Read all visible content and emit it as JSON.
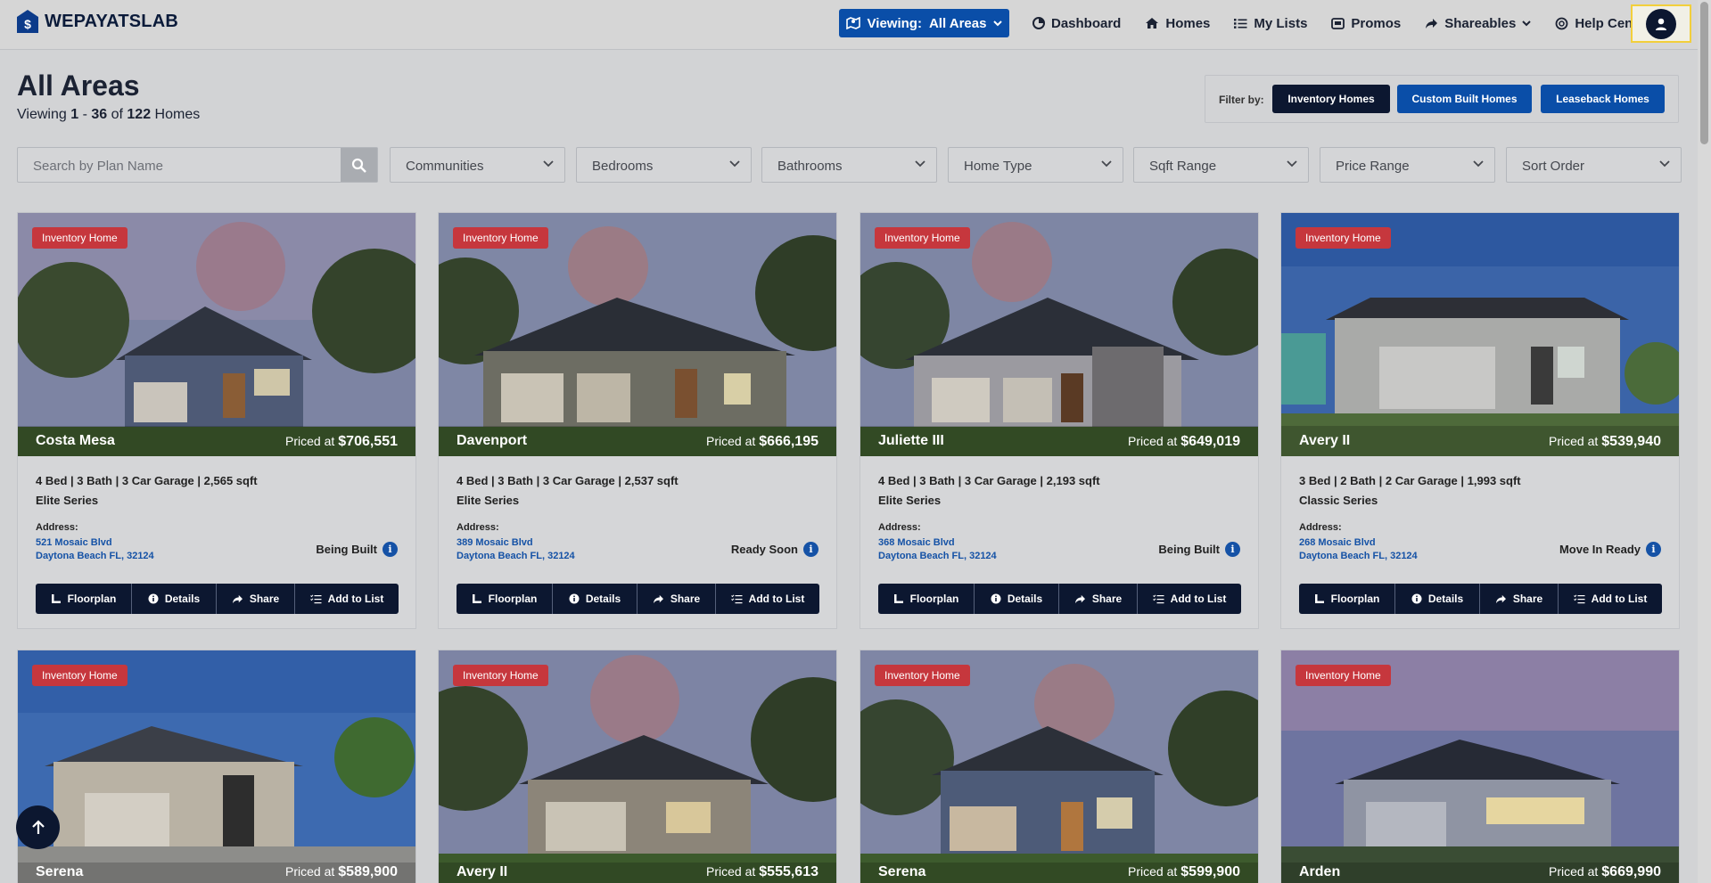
{
  "brand": {
    "name": "WEPAYATSLAB"
  },
  "header": {
    "viewing_label": "Viewing:",
    "viewing_value": "All Areas",
    "nav": [
      {
        "label": "Dashboard",
        "icon": "dashboard-icon"
      },
      {
        "label": "Homes",
        "icon": "home-icon"
      },
      {
        "label": "My Lists",
        "icon": "list-icon"
      },
      {
        "label": "Promos",
        "icon": "promo-icon"
      },
      {
        "label": "Shareables",
        "icon": "share-icon"
      },
      {
        "label": "Help Center",
        "icon": "help-icon"
      }
    ]
  },
  "page": {
    "title": "All Areas",
    "viewing_prefix": "Viewing",
    "range_start": "1",
    "range_sep": "-",
    "range_end": "36",
    "of": "of",
    "total": "122",
    "unit": "Homes"
  },
  "filter": {
    "label": "Filter by:",
    "buttons": [
      "Inventory Homes",
      "Custom Built Homes",
      "Leaseback Homes"
    ]
  },
  "search": {
    "placeholder": "Search by Plan Name"
  },
  "dropdowns": [
    "Communities",
    "Bedrooms",
    "Bathrooms",
    "Home Type",
    "Sqft Range",
    "Price Range",
    "Sort Order"
  ],
  "card_actions": [
    "Floorplan",
    "Details",
    "Share",
    "Add to List"
  ],
  "address_label": "Address:",
  "price_prefix": "Priced at",
  "homes": [
    {
      "badge": "Inventory Home",
      "name": "Costa Mesa",
      "price": "$706,551",
      "specs": "4 Bed | 3 Bath | 3 Car Garage | 2,565 sqft",
      "series": "Elite Series",
      "addr1": "521 Mosaic Blvd",
      "addr2": "Daytona Beach FL, 32124",
      "status": "Being Built"
    },
    {
      "badge": "Inventory Home",
      "name": "Davenport",
      "price": "$666,195",
      "specs": "4 Bed | 3 Bath | 3 Car Garage | 2,537 sqft",
      "series": "Elite Series",
      "addr1": "389 Mosaic Blvd",
      "addr2": "Daytona Beach FL, 32124",
      "status": "Ready Soon"
    },
    {
      "badge": "Inventory Home",
      "name": "Juliette III",
      "price": "$649,019",
      "specs": "4 Bed | 3 Bath | 3 Car Garage | 2,193 sqft",
      "series": "Elite Series",
      "addr1": "368 Mosaic Blvd",
      "addr2": "Daytona Beach FL, 32124",
      "status": "Being Built"
    },
    {
      "badge": "Inventory Home",
      "name": "Avery II",
      "price": "$539,940",
      "specs": "3 Bed | 2 Bath | 2 Car Garage | 1,993 sqft",
      "series": "Classic Series",
      "addr1": "268 Mosaic Blvd",
      "addr2": "Daytona Beach FL, 32124",
      "status": "Move In Ready"
    },
    {
      "badge": "Inventory Home",
      "name": "Serena",
      "price": "$589,900"
    },
    {
      "badge": "Inventory Home",
      "name": "Avery II",
      "price": "$555,613"
    },
    {
      "badge": "Inventory Home",
      "name": "Serena",
      "price": "$599,900"
    },
    {
      "badge": "Inventory Home",
      "name": "Arden",
      "price": "$669,990"
    }
  ]
}
